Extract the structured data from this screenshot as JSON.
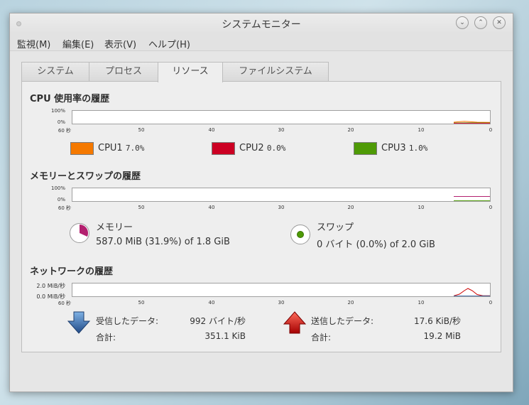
{
  "window": {
    "title": "システムモニター"
  },
  "menu": [
    "監視(M)",
    "編集(E)",
    "表示(V)",
    "ヘルプ(H)"
  ],
  "tabs": [
    {
      "label": "システム"
    },
    {
      "label": "プロセス"
    },
    {
      "label": "リソース",
      "active": true
    },
    {
      "label": "ファイルシステム"
    }
  ],
  "cpu": {
    "title": "CPU 使用率の履歴",
    "y_top": "100%",
    "y_bottom": "0%",
    "cores": [
      {
        "name": "CPU1",
        "value": "7.0%",
        "color": "#f57900"
      },
      {
        "name": "CPU2",
        "value": "0.0%",
        "color": "#cc0023"
      },
      {
        "name": "CPU3",
        "value": "1.0%",
        "color": "#4e9a06"
      }
    ]
  },
  "time_axis": [
    "60 秒",
    "50",
    "40",
    "30",
    "20",
    "10",
    "0"
  ],
  "memory": {
    "title": "メモリーとスワップの履歴",
    "y_top": "100%",
    "y_bottom": "0%",
    "mem_label": "メモリー",
    "mem_detail": "587.0 MiB (31.9%) of 1.8 GiB",
    "mem_fraction": 0.319,
    "mem_color": "#b3206f",
    "swap_label": "スワップ",
    "swap_detail": "0 バイト (0.0%) of 2.0 GiB",
    "swap_fraction": 0.0,
    "swap_color": "#4e9a06"
  },
  "network": {
    "title": "ネットワークの履歴",
    "y_top": "2.0 MiB/秒",
    "y_bottom": "0.0 MiB/秒",
    "recv_label": "受信したデータ:",
    "recv_rate": "992 バイト/秒",
    "recv_total_label": "合計:",
    "recv_total": "351.1 KiB",
    "send_label": "送信したデータ:",
    "send_rate": "17.6 KiB/秒",
    "send_total_label": "合計:",
    "send_total": "19.2 MiB",
    "recv_color": "#3465a4",
    "send_color": "#cc0000"
  }
}
